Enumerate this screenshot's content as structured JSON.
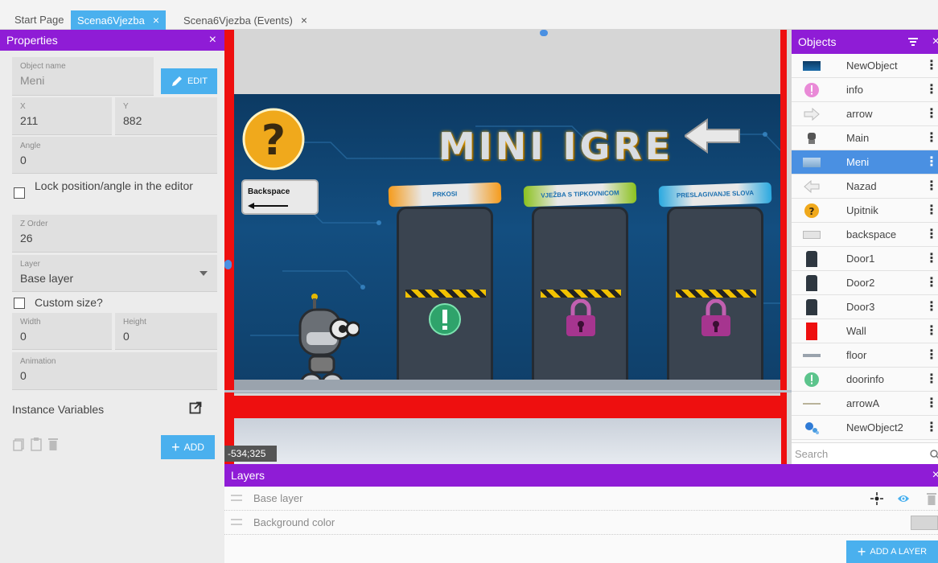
{
  "tabs": [
    {
      "label": "Start Page"
    },
    {
      "label": "Scena6Vjezba",
      "close": "×"
    },
    {
      "label": "Scena6Vjezba (Events)",
      "close": "×"
    }
  ],
  "properties": {
    "title": "Properties",
    "close": "×",
    "object_name_label": "Object name",
    "object_name_value": "Meni",
    "edit_label": "EDIT",
    "x_label": "X",
    "x_value": "211",
    "y_label": "Y",
    "y_value": "882",
    "angle_label": "Angle",
    "angle_value": "0",
    "lock_label": "Lock position/angle in the editor",
    "lock_checked": false,
    "zorder_label": "Z Order",
    "zorder_value": "26",
    "layer_label": "Layer",
    "layer_value": "Base layer",
    "custom_size_label": "Custom size?",
    "custom_size_checked": false,
    "width_label": "Width",
    "width_value": "0",
    "height_label": "Height",
    "height_value": "0",
    "animation_label": "Animation",
    "animation_value": "0",
    "instance_vars_label": "Instance Variables",
    "add_label": "ADD"
  },
  "scene": {
    "cursor_coords": "-534;325",
    "game_title": "MINI IGRE",
    "backspace_label": "Backspace",
    "door_labels": [
      "PRKOSI",
      "VJEŽBA S TIPKOVNICOM",
      "PRESLAGIVANJE SLOVA"
    ],
    "door_states": [
      "unlocked",
      "locked",
      "locked"
    ]
  },
  "objects": {
    "title": "Objects",
    "close": "×",
    "search_placeholder": "Search",
    "items": [
      {
        "name": "NewObject",
        "icon": "sprite-thumbnail-icon",
        "selected": false
      },
      {
        "name": "info",
        "icon": "exclamation-icon",
        "selected": false
      },
      {
        "name": "arrow",
        "icon": "arrow-right-icon",
        "selected": false
      },
      {
        "name": "Main",
        "icon": "robot-icon",
        "selected": false
      },
      {
        "name": "Meni",
        "icon": "menu-background-icon",
        "selected": true
      },
      {
        "name": "Nazad",
        "icon": "arrow-left-icon",
        "selected": false
      },
      {
        "name": "Upitnik",
        "icon": "question-icon",
        "selected": false
      },
      {
        "name": "backspace",
        "icon": "backspace-key-icon",
        "selected": false
      },
      {
        "name": "Door1",
        "icon": "door-icon",
        "selected": false
      },
      {
        "name": "Door2",
        "icon": "door-icon",
        "selected": false
      },
      {
        "name": "Door3",
        "icon": "door-icon",
        "selected": false
      },
      {
        "name": "Wall",
        "icon": "wall-icon",
        "selected": false
      },
      {
        "name": "floor",
        "icon": "floor-icon",
        "selected": false
      },
      {
        "name": "doorinfo",
        "icon": "exclamation-green-icon",
        "selected": false
      },
      {
        "name": "arrowA",
        "icon": "arrow-line-icon",
        "selected": false
      },
      {
        "name": "NewObject2",
        "icon": "particles-icon",
        "selected": false
      }
    ]
  },
  "layers": {
    "title": "Layers",
    "close": "×",
    "items": [
      {
        "name": "Base layer"
      },
      {
        "name": "Background color"
      }
    ],
    "add_layer_label": "ADD A LAYER"
  },
  "colors": {
    "panel_header": "#8f1cd6",
    "accent_blue": "#4ab0ee",
    "selected_row": "#4a90e2",
    "wall_red": "#ee0f0f"
  }
}
